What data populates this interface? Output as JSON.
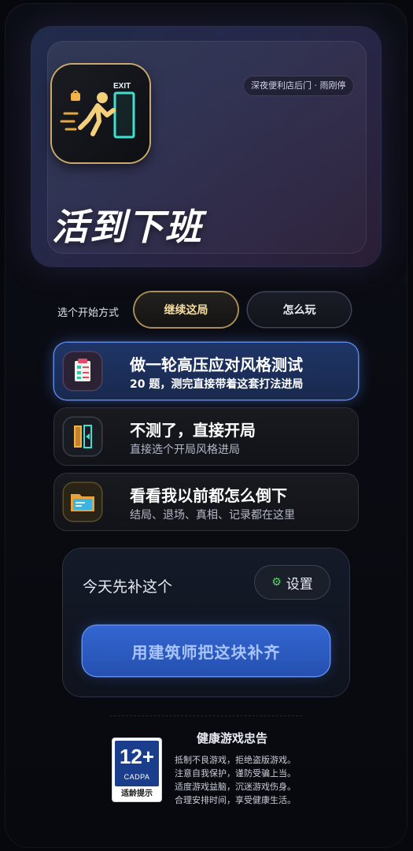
{
  "app": {
    "title": "活到下班",
    "location": "深夜便利店后门 · 雨刚停",
    "icon": "exit-runner-icon",
    "icon_exit_text": "EXIT"
  },
  "start": {
    "label": "选个开始方式",
    "continue_label": "继续这局",
    "howto_label": "怎么玩"
  },
  "options": [
    {
      "title": "做一轮高压应对风格测试",
      "subtitle": "20 题，测完直接带着这套打法进局",
      "icon": "clipboard-test-icon"
    },
    {
      "title": "不测了，直接开局",
      "subtitle": "直接选个开局风格进局",
      "icon": "door-start-icon"
    },
    {
      "title": "看看我以前都怎么倒下",
      "subtitle": "结局、退场、真相、记录都在这里",
      "icon": "folder-records-icon"
    }
  ],
  "daily": {
    "title": "今天先补这个",
    "settings_label": "设置",
    "builder_label": "用建筑师把这块补齐"
  },
  "notice": {
    "title": "健康游戏忠告",
    "lines": [
      "抵制不良游戏，拒绝盗版游戏。",
      "注意自我保护，谨防受骗上当。",
      "适度游戏益脑，沉迷游戏伤身。",
      "合理安排时间，享受健康生活。"
    ],
    "age_rating": "12+",
    "rating_org": "CADPA",
    "rating_caption": "适龄提示"
  },
  "colors": {
    "accent_blue": "#3366d1",
    "accent_gold": "#c9a96b",
    "neon_cyan": "#3fe0d0"
  }
}
